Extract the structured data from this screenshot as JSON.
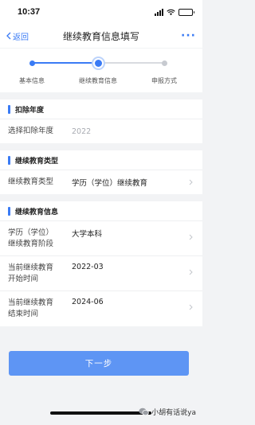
{
  "status_bar": {
    "time": "10:37"
  },
  "nav": {
    "back_label": "返回",
    "title": "继续教育信息填写",
    "more_label": "···"
  },
  "steps": [
    {
      "label": "基本信息",
      "state": "done"
    },
    {
      "label": "继续教育信息",
      "state": "current"
    },
    {
      "label": "申报方式",
      "state": "pending"
    }
  ],
  "sections": {
    "deduction_year": {
      "title": "扣除年度",
      "row_label": "选择扣除年度",
      "row_value": "2022"
    },
    "education_type": {
      "title": "继续教育类型",
      "row_label": "继续教育类型",
      "row_value": "学历（学位）继续教育"
    },
    "education_info": {
      "title": "继续教育信息",
      "rows": [
        {
          "label_line1": "学历（学位）",
          "label_line2": "继续教育阶段",
          "value": "大学本科"
        },
        {
          "label_line1": "当前继续教育",
          "label_line2": "开始时间",
          "value": "2022-03"
        },
        {
          "label_line1": "当前继续教育",
          "label_line2": "结束时间",
          "value": "2024-06"
        }
      ]
    }
  },
  "next_button_label": "下一步",
  "watermark": "小胡有话说ya",
  "colors": {
    "accent": "#3a7bf5",
    "button": "#5e95f4",
    "background": "#f2f3f5"
  }
}
